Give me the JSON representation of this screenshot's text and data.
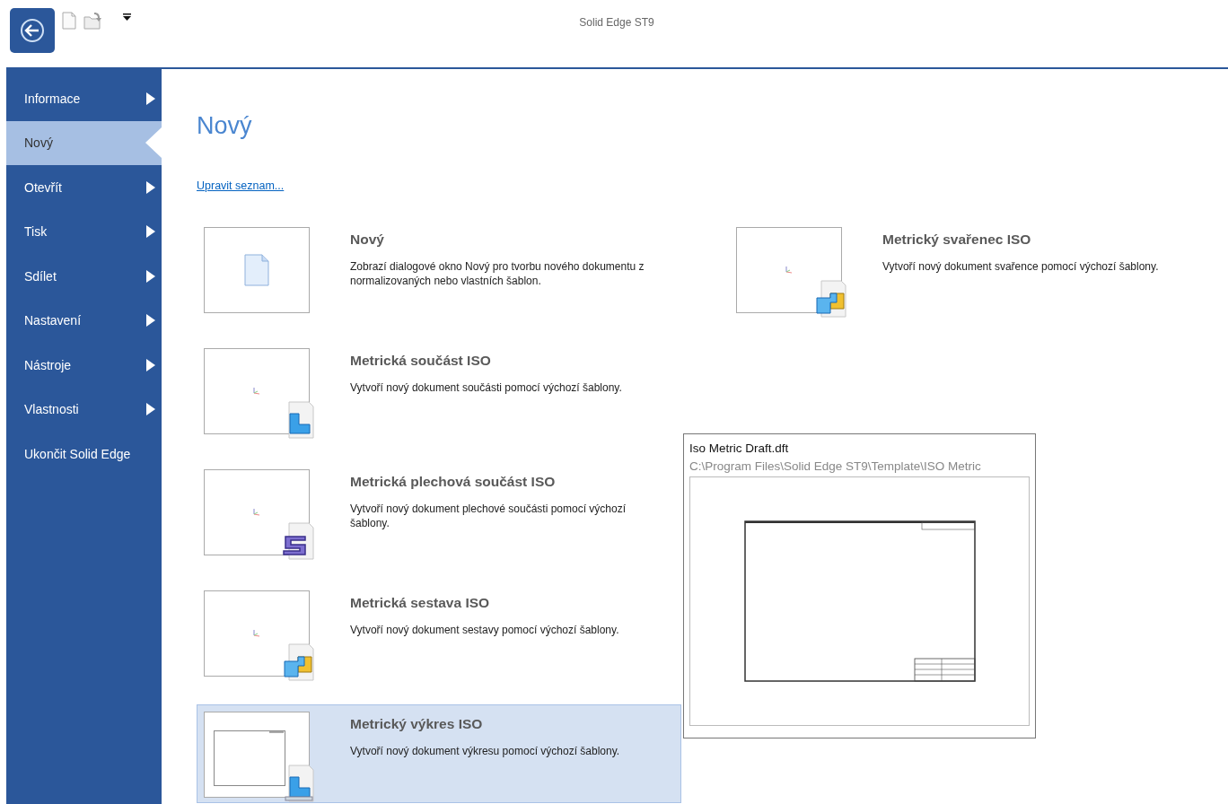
{
  "window": {
    "title": "Solid Edge ST9"
  },
  "sidebar": {
    "items": [
      {
        "label": "Informace",
        "selected": false,
        "has_submenu": true
      },
      {
        "label": "Nový",
        "selected": true,
        "has_submenu": false
      },
      {
        "label": "Otevřít",
        "selected": false,
        "has_submenu": true
      },
      {
        "label": "Tisk",
        "selected": false,
        "has_submenu": true
      },
      {
        "label": "Sdílet",
        "selected": false,
        "has_submenu": true
      },
      {
        "label": "Nastavení",
        "selected": false,
        "has_submenu": true
      },
      {
        "label": "Nástroje",
        "selected": false,
        "has_submenu": true
      },
      {
        "label": "Vlastnosti",
        "selected": false,
        "has_submenu": true
      },
      {
        "label": "Ukončit Solid Edge",
        "selected": false,
        "has_submenu": false
      }
    ]
  },
  "page": {
    "title": "Nový",
    "edit_link": "Upravit seznam...",
    "template_columns": [
      {
        "templates": [
          {
            "kind": "blank",
            "title": "Nový",
            "description": "Zobrazí dialogové okno Nový pro tvorbu nového dokumentu z normalizovaných nebo vlastních šablon.",
            "selected": false
          },
          {
            "kind": "part",
            "title": "Metrická součást ISO",
            "description": "Vytvoří nový dokument součásti pomocí výchozí šablony.",
            "selected": false
          },
          {
            "kind": "sheet_metal",
            "title": "Metrická plechová součást ISO",
            "description": "Vytvoří nový dokument plechové součásti pomocí výchozí šablony.",
            "selected": false
          },
          {
            "kind": "assembly",
            "title": "Metrická sestava ISO",
            "description": "Vytvoří nový dokument sestavy pomocí výchozí šablony.",
            "selected": false
          },
          {
            "kind": "draft",
            "title": "Metrický výkres ISO",
            "description": "Vytvoří nový dokument výkresu pomocí výchozí šablony.",
            "selected": true
          }
        ]
      },
      {
        "templates": [
          {
            "kind": "weldment",
            "title": "Metrický svařenec ISO",
            "description": "Vytvoří nový dokument svařence pomocí výchozí šablony.",
            "selected": false
          }
        ]
      }
    ]
  },
  "tooltip": {
    "title": "Iso Metric Draft.dft",
    "path": "C:\\Program Files\\Solid Edge ST9\\Template\\ISO Metric"
  }
}
